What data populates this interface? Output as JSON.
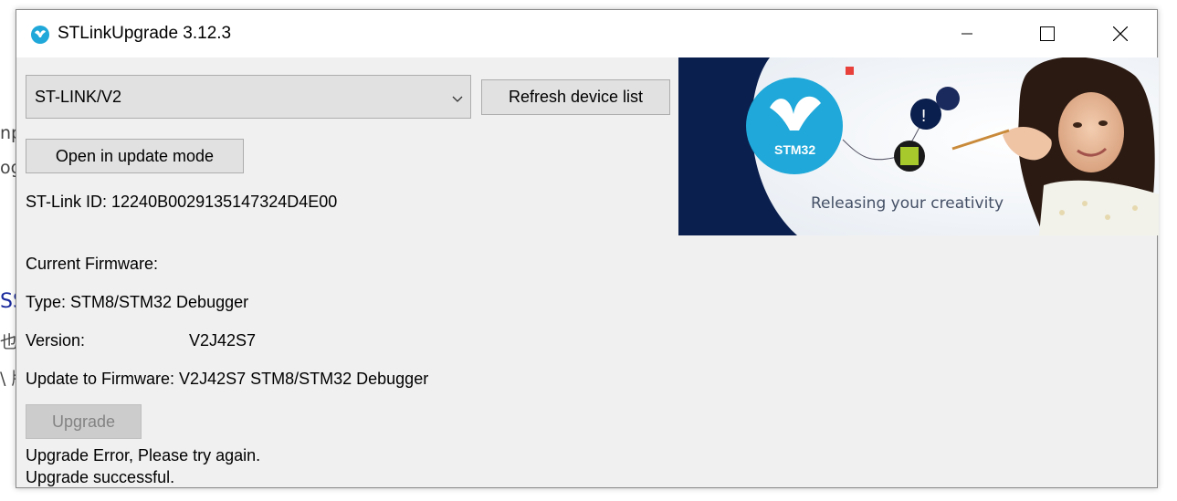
{
  "background_fragments": [
    "np",
    "og",
    "SS",
    "也",
    "\\ 版"
  ],
  "window": {
    "title": "STLinkUpgrade 3.12.3",
    "icon": "st-logo-icon",
    "controls": [
      "minimize-icon",
      "maximize-icon",
      "close-icon"
    ]
  },
  "device": {
    "selected": "ST-LINK/V2",
    "refresh_label": "Refresh device list",
    "open_label": "Open in update mode",
    "stlink_id": "ST-Link ID: 12240B0029135147324D4E00"
  },
  "firmware": {
    "current_label": "Current Firmware:",
    "type": "Type: STM8/STM32 Debugger",
    "version_label": "Version:",
    "version_value": "V2J42S7",
    "update_to": "Update to Firmware: V2J42S7 STM8/STM32 Debugger"
  },
  "actions": {
    "upgrade_label": "Upgrade"
  },
  "status": {
    "line1": "Upgrade Error, Please try again.",
    "line2": "Upgrade successful."
  },
  "banner": {
    "badge": "STM32",
    "tagline": "Releasing your creativity"
  },
  "colors": {
    "banner_navy": "#0b1f4e",
    "badge_blue": "#1fa8d9",
    "disabled_text": "#838383"
  }
}
